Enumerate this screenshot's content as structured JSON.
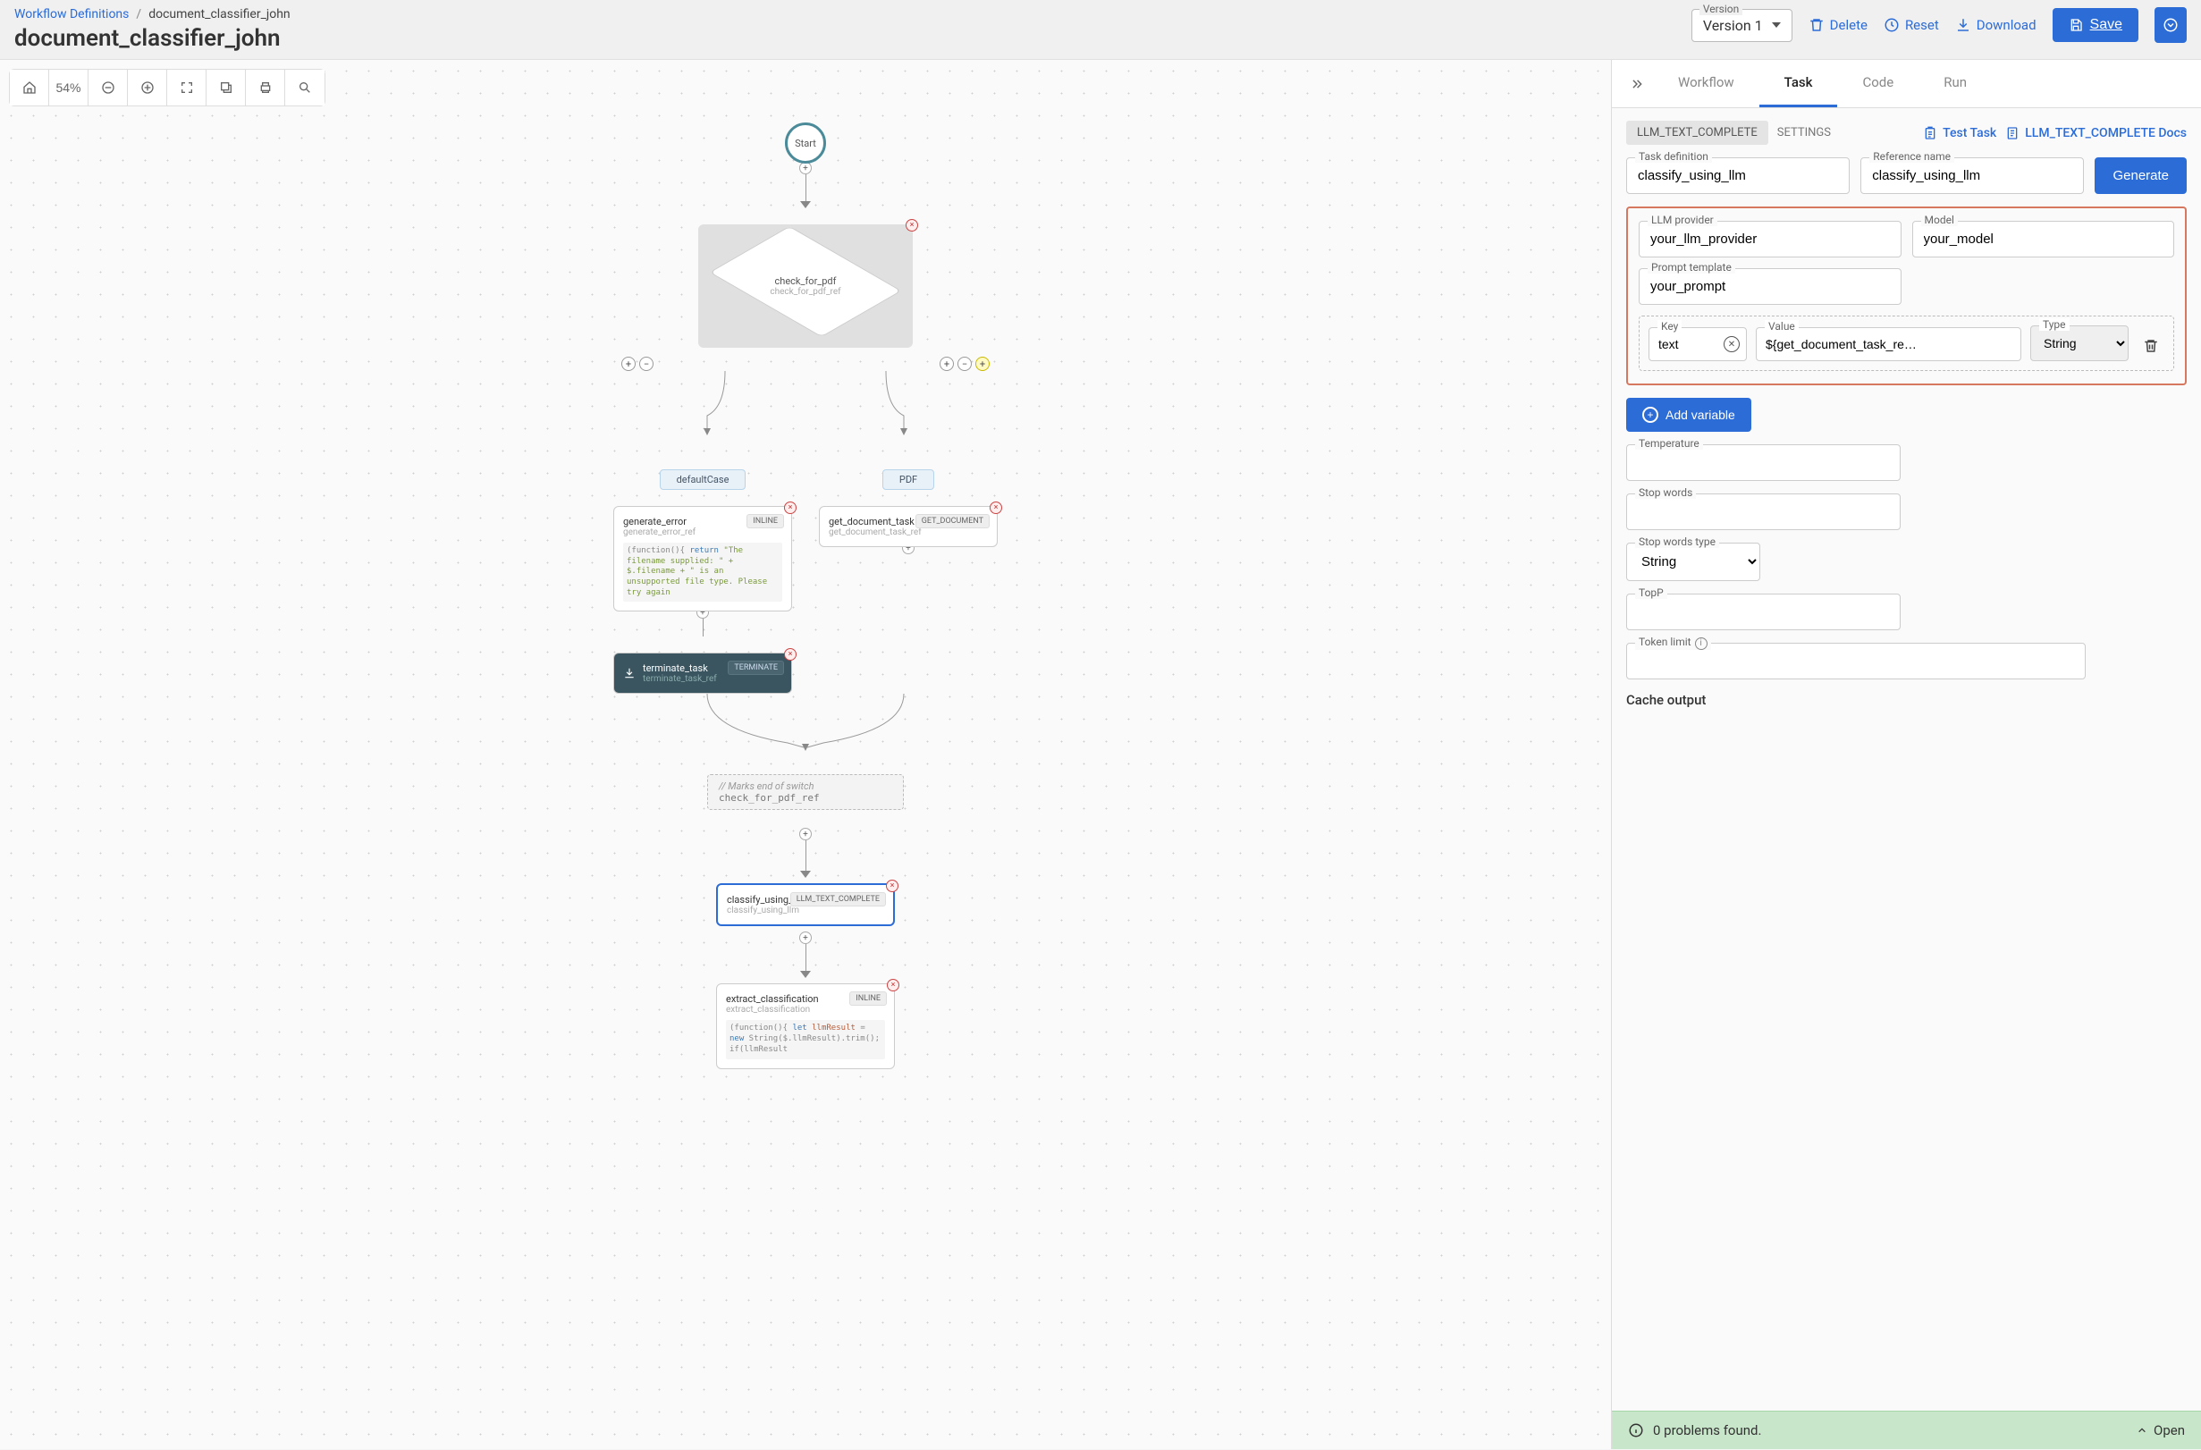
{
  "breadcrumb": {
    "parent": "Workflow Definitions",
    "current": "document_classifier_john"
  },
  "page_title": "document_classifier_john",
  "version": {
    "label": "Version",
    "value": "Version 1"
  },
  "actions": {
    "delete": "Delete",
    "reset": "Reset",
    "download": "Download",
    "save": "Save"
  },
  "canvas_toolbar": {
    "zoom": "54%"
  },
  "flow": {
    "start": "Start",
    "decision": {
      "name": "check_for_pdf",
      "ref": "check_for_pdf_ref"
    },
    "branch_left": "defaultCase",
    "branch_right": "PDF",
    "gen_error": {
      "name": "generate_error",
      "ref": "generate_error_ref",
      "tag": "INLINE",
      "snippet_p1": "(function(){ ",
      "snippet_kw1": "return",
      "snippet_p2": " \"The filename supplied: \" + $.filename + \" is an unsupported file type. Please try again",
      "snippet_tail": "…"
    },
    "get_doc": {
      "name": "get_document_task",
      "ref": "get_document_task_ref",
      "tag": "GET_DOCUMENT"
    },
    "terminate": {
      "name": "terminate_task",
      "ref": "terminate_task_ref",
      "tag": "TERMINATE"
    },
    "merge": {
      "comment": "// Marks end of switch",
      "ref": "check_for_pdf_ref"
    },
    "classify": {
      "name": "classify_using_llm",
      "ref": "classify_using_llm",
      "tag": "LLM_TEXT_COMPLETE"
    },
    "extract": {
      "name": "extract_classification",
      "ref": "extract_classification",
      "tag": "INLINE",
      "snippet_p1": "(function(){ ",
      "snippet_kw1": "let",
      "snippet_var": " llmResult",
      "snippet_p2": " = ",
      "snippet_kw2": "new",
      "snippet_p3": " String($.llmResult).trim(); if(llmResult"
    }
  },
  "panel": {
    "tabs": {
      "workflow": "Workflow",
      "task": "Task",
      "code": "Code",
      "run": "Run"
    },
    "chip1": "LLM_TEXT_COMPLETE",
    "chip2": "SETTINGS",
    "test_task": "Test Task",
    "docs_link": "LLM_TEXT_COMPLETE Docs",
    "task_def_label": "Task definition",
    "task_def_value": "classify_using_llm",
    "ref_name_label": "Reference name",
    "ref_name_value": "classify_using_llm",
    "generate": "Generate",
    "llm_provider_label": "LLM provider",
    "llm_provider_value": "your_llm_provider",
    "model_label": "Model",
    "model_value": "your_model",
    "prompt_label": "Prompt template",
    "prompt_value": "your_prompt",
    "kv": {
      "key_label": "Key",
      "key_value": "text",
      "value_label": "Value",
      "value_value": "${get_document_task_re…",
      "type_label": "Type",
      "type_value": "String"
    },
    "add_variable": "Add variable",
    "temperature_label": "Temperature",
    "stopwords_label": "Stop words",
    "stopwords_type_label": "Stop words type",
    "stopwords_type_value": "String",
    "topp_label": "TopP",
    "token_limit_label": "Token limit",
    "cache_output": "Cache output"
  },
  "status": {
    "message": "0 problems found.",
    "open": "Open"
  }
}
